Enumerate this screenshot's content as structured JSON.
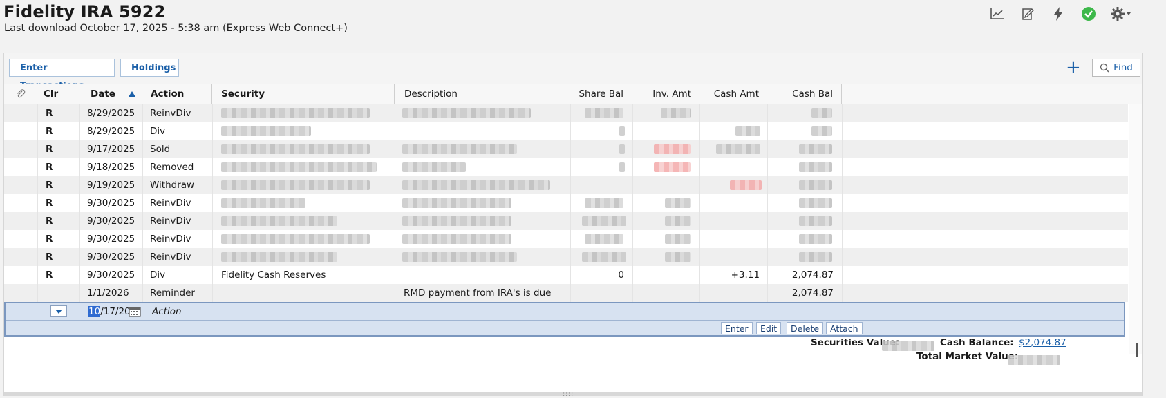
{
  "header": {
    "title": "Fidelity IRA 5922",
    "subtitle": "Last download October 17, 2025 - 5:38 am (Express Web Connect+)"
  },
  "toolbar_icons": [
    "chart-icon",
    "report-icon",
    "lightning-icon",
    "online-status-icon",
    "gear-icon"
  ],
  "tabs": {
    "enter_transactions": "Enter Transactions",
    "holdings": "Holdings"
  },
  "find": {
    "label": "Find"
  },
  "columns": {
    "clr": "Clr",
    "date": "Date",
    "action": "Action",
    "security": "Security",
    "description": "Description",
    "share_bal": "Share Bal",
    "inv_amt": "Inv. Amt",
    "cash_amt": "Cash Amt",
    "cash_bal": "Cash Bal"
  },
  "rows": [
    {
      "clr": "R",
      "date": "8/29/2025",
      "action": "ReinvDiv"
    },
    {
      "clr": "R",
      "date": "8/29/2025",
      "action": "Div"
    },
    {
      "clr": "R",
      "date": "9/17/2025",
      "action": "Sold"
    },
    {
      "clr": "R",
      "date": "9/18/2025",
      "action": "Removed"
    },
    {
      "clr": "R",
      "date": "9/19/2025",
      "action": "Withdraw"
    },
    {
      "clr": "R",
      "date": "9/30/2025",
      "action": "ReinvDiv"
    },
    {
      "clr": "R",
      "date": "9/30/2025",
      "action": "ReinvDiv"
    },
    {
      "clr": "R",
      "date": "9/30/2025",
      "action": "ReinvDiv"
    },
    {
      "clr": "R",
      "date": "9/30/2025",
      "action": "ReinvDiv"
    },
    {
      "clr": "R",
      "date": "9/30/2025",
      "action": "Div",
      "security": "Fidelity Cash Reserves",
      "share_bal": "0",
      "cash_amt": "+3.11",
      "cash_bal": "2,074.87"
    },
    {
      "clr": "",
      "date": "1/1/2026",
      "action": "Reminder",
      "description": "RMD payment from IRA's is due",
      "cash_bal": "2,074.87"
    }
  ],
  "edit_row": {
    "date_selected": "10",
    "date_rest": "/17/202",
    "action_placeholder": "Action",
    "buttons": {
      "enter": "Enter",
      "edit": "Edit",
      "delete": "Delete",
      "attach": "Attach"
    }
  },
  "totals": {
    "securities_value_label": "Securities Value:",
    "cash_balance_label": "Cash Balance:",
    "cash_balance_value": "$2,074.87",
    "total_market_value_label": "Total Market Value:"
  },
  "colors": {
    "accent_blue": "#1a5fa8",
    "edit_row_bg": "#d7e2f1",
    "separator_teal": "#7fd3cf",
    "status_green": "#3db84a"
  }
}
